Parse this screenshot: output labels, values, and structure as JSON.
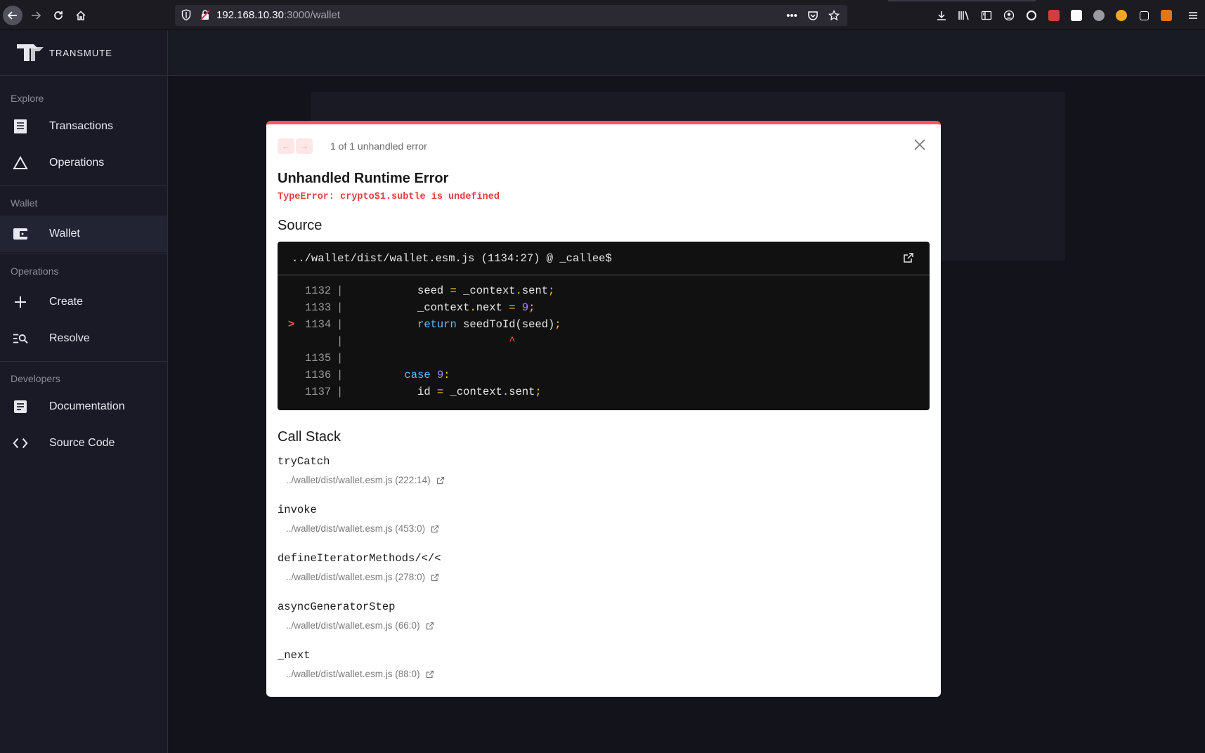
{
  "browser": {
    "url_host": "192.168.10.30",
    "url_rest": ":3000/wallet"
  },
  "app": {
    "logo_text": "TRANSMUTE"
  },
  "sidebar": {
    "sections": [
      {
        "title": "Explore",
        "items": [
          {
            "label": "Transactions",
            "icon": "receipt-icon"
          },
          {
            "label": "Operations",
            "icon": "triangle-icon"
          }
        ]
      },
      {
        "title": "Wallet",
        "items": [
          {
            "label": "Wallet",
            "icon": "wallet-icon",
            "active": true
          }
        ]
      },
      {
        "title": "Operations",
        "items": [
          {
            "label": "Create",
            "icon": "plus-icon"
          },
          {
            "label": "Resolve",
            "icon": "search-list-icon"
          }
        ]
      },
      {
        "title": "Developers",
        "items": [
          {
            "label": "Documentation",
            "icon": "document-icon"
          },
          {
            "label": "Source Code",
            "icon": "code-icon"
          }
        ]
      }
    ]
  },
  "error_overlay": {
    "count_text": "1 of 1 unhandled error",
    "title": "Unhandled Runtime Error",
    "message": "TypeError: crypto$1.subtle is undefined",
    "source_heading": "Source",
    "source_file": "../wallet/dist/wallet.esm.js (1134:27) @ _callee$",
    "callstack_heading": "Call Stack",
    "code_lines": [
      {
        "marker": "",
        "line": "1132",
        "code": "seed = _context.sent;"
      },
      {
        "marker": "",
        "line": "1133",
        "code": "_context.next = 9;"
      },
      {
        "marker": ">",
        "line": "1134",
        "code": "return seedToId(seed);"
      },
      {
        "marker": "",
        "line": "",
        "code": "^"
      },
      {
        "marker": "",
        "line": "1135",
        "code": ""
      },
      {
        "marker": "",
        "line": "1136",
        "code": "case 9:"
      },
      {
        "marker": "",
        "line": "1137",
        "code": "id = _context.sent;"
      }
    ],
    "stack": [
      {
        "fn": "tryCatch",
        "loc": "../wallet/dist/wallet.esm.js (222:14)"
      },
      {
        "fn": "invoke",
        "loc": "../wallet/dist/wallet.esm.js (453:0)"
      },
      {
        "fn": "defineIteratorMethods/</<",
        "loc": "../wallet/dist/wallet.esm.js (278:0)"
      },
      {
        "fn": "asyncGeneratorStep",
        "loc": "../wallet/dist/wallet.esm.js (66:0)"
      },
      {
        "fn": "_next",
        "loc": "../wallet/dist/wallet.esm.js (88:0)"
      }
    ]
  }
}
